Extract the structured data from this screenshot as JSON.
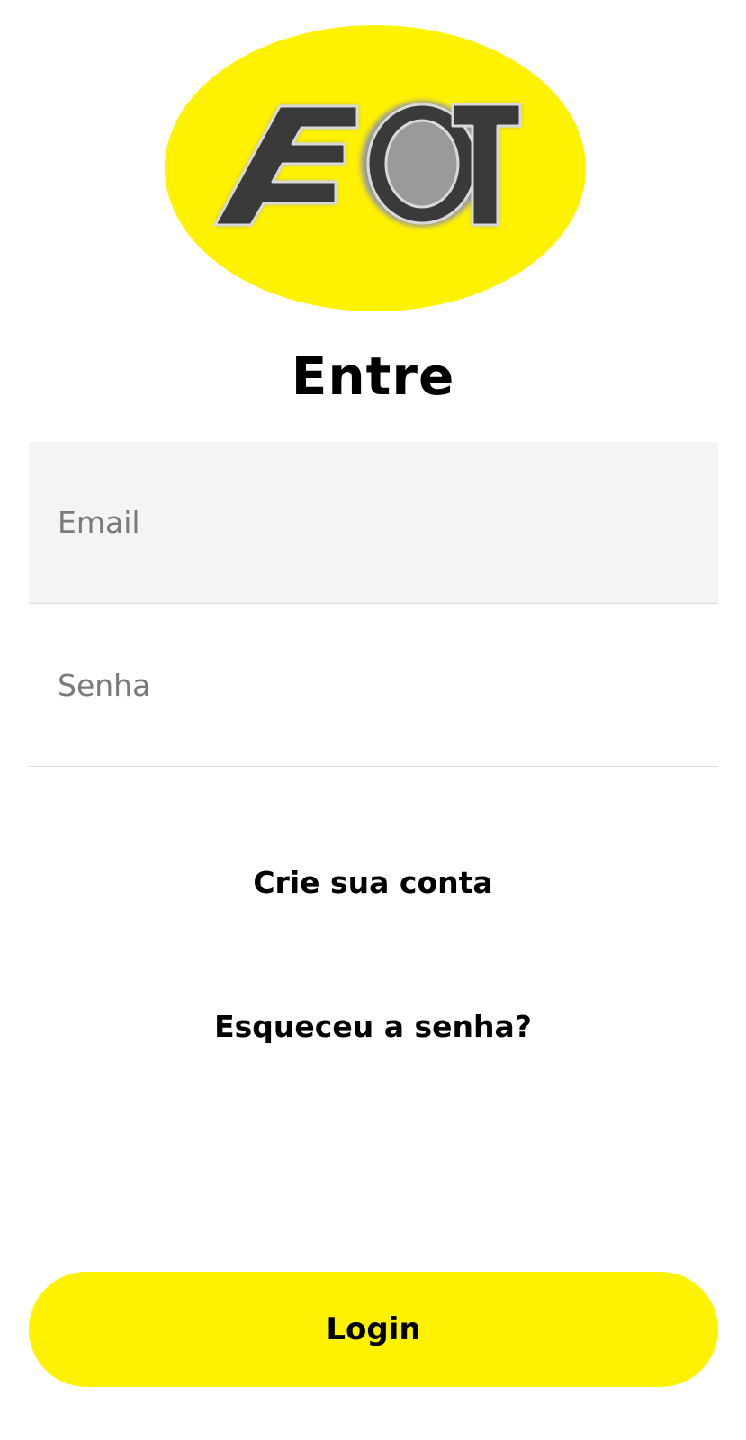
{
  "logo": {
    "text": "AEOT",
    "background_color": "#fff200",
    "letter_color": "#3a3a3a"
  },
  "header": {
    "title": "Entre"
  },
  "form": {
    "email_placeholder": "Email",
    "password_placeholder": "Senha"
  },
  "links": {
    "create_account": "Crie sua conta",
    "forgot_password": "Esqueceu a senha?"
  },
  "actions": {
    "login_label": "Login"
  },
  "colors": {
    "accent": "#fff200",
    "field_background": "#f4f4f4",
    "divider": "#dcdcdc"
  }
}
